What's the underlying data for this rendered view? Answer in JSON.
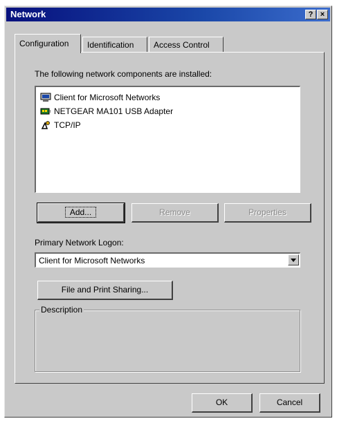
{
  "window": {
    "title": "Network",
    "help_button": "?",
    "close_button": "×"
  },
  "tabs": [
    {
      "label": "Configuration",
      "active": true
    },
    {
      "label": "Identification",
      "active": false
    },
    {
      "label": "Access Control",
      "active": false
    }
  ],
  "configuration": {
    "components_label": "The following network components are installed:",
    "components": [
      {
        "label": "Client for Microsoft Networks",
        "icon": "network-client-icon"
      },
      {
        "label": "NETGEAR MA101 USB Adapter",
        "icon": "network-adapter-icon"
      },
      {
        "label": "TCP/IP",
        "icon": "protocol-icon"
      }
    ],
    "add_button": "Add...",
    "remove_button": "Remove",
    "properties_button": "Properties",
    "logon_label": "Primary Network Logon:",
    "logon_value": "Client for Microsoft Networks",
    "file_print_button": "File and Print Sharing...",
    "description_label": "Description"
  },
  "footer": {
    "ok_button": "OK",
    "cancel_button": "Cancel"
  }
}
